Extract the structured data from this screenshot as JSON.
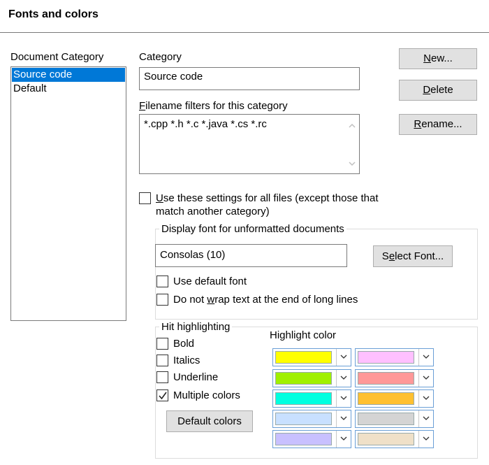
{
  "page": {
    "title": "Fonts and colors"
  },
  "document_category": {
    "label": "Document Category",
    "items": [
      {
        "label": "Source code",
        "selected": true
      },
      {
        "label": "Default",
        "selected": false
      }
    ]
  },
  "category": {
    "label": "Category",
    "value": "Source code"
  },
  "filters": {
    "label_mnemonic": "F",
    "label_rest": "ilename filters for this category",
    "value": "*.cpp *.h *.c *.java *.cs *.rc"
  },
  "buttons": {
    "new": {
      "mnemonic": "N",
      "rest": "ew..."
    },
    "delete": {
      "mnemonic": "D",
      "rest": "elete"
    },
    "rename": {
      "mnemonic": "R",
      "rest": "ename..."
    }
  },
  "use_all": {
    "checked": false,
    "mnemonic": "U",
    "line1_rest": "se these settings for all files (except those that",
    "line2": "match another category)"
  },
  "display_font": {
    "caption": "Display font for unformatted documents",
    "font_value": "Consolas (10)",
    "select_btn_pre": "S",
    "select_btn_mnemonic": "e",
    "select_btn_rest": "lect Font...",
    "use_default": {
      "checked": false,
      "label": "Use default font"
    },
    "no_wrap": {
      "checked": false,
      "pre": "Do not ",
      "mnemonic": "w",
      "rest": "rap text at the end of long lines"
    }
  },
  "hit_highlighting": {
    "caption": "Hit highlighting",
    "color_label": "Highlight color",
    "bold": {
      "checked": false,
      "label": "Bold"
    },
    "italics": {
      "checked": false,
      "label": "Italics"
    },
    "underline": {
      "checked": false,
      "label": "Underline"
    },
    "multiple": {
      "checked": true,
      "label": "Multiple colors"
    },
    "default_colors_label": "Default colors",
    "colors": [
      [
        "#ffff00",
        "#ffc0ff"
      ],
      [
        "#a0f000",
        "#ff9898"
      ],
      [
        "#00ffe0",
        "#ffc030"
      ],
      [
        "#c8e0ff",
        "#d4d4d4"
      ],
      [
        "#c8c0ff",
        "#efe0c8"
      ]
    ]
  }
}
